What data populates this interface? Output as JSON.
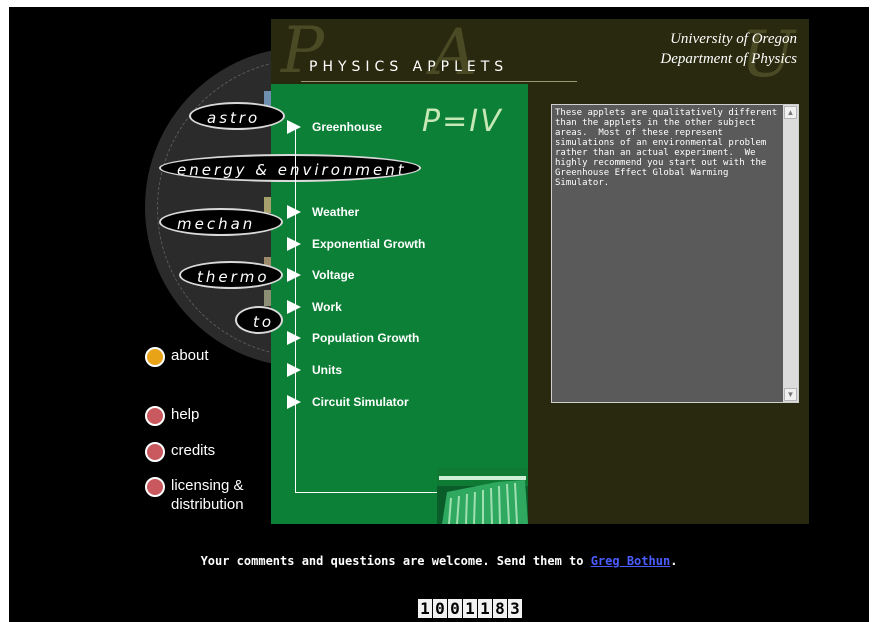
{
  "header": {
    "title": "PHYSICS APPLETS",
    "university": "University of Oregon",
    "department": "Department of Physics"
  },
  "subjects": [
    {
      "label": "astro"
    },
    {
      "label": "energy & environment"
    },
    {
      "label": "mechan"
    },
    {
      "label": "thermo"
    },
    {
      "label": "to"
    }
  ],
  "side_links": [
    {
      "label": "about",
      "color": "#e8a317"
    },
    {
      "label": "help",
      "color": "#c9595f"
    },
    {
      "label": "credits",
      "color": "#c9595f"
    },
    {
      "label": "licensing &\ndistribution",
      "color": "#c9595f"
    }
  ],
  "formula": "P=IV",
  "applets": [
    {
      "label": "Greenhouse"
    },
    {
      "label": "Weather"
    },
    {
      "label": "Exponential Growth"
    },
    {
      "label": "Voltage"
    },
    {
      "label": "Work"
    },
    {
      "label": "Population Growth"
    },
    {
      "label": "Units"
    },
    {
      "label": "Circuit Simulator"
    }
  ],
  "description": "These applets are qualitatively different than the applets in the other subject areas.  Most of these represent simulations of an environmental problem rather than an actual experiment.  We highly recommend you start out with the Greenhouse Effect Global Warming Simulator.",
  "footer": {
    "text": "Your comments and questions are welcome. Send them to ",
    "link": "Greg Bothun",
    "end": "."
  },
  "counter": [
    "1",
    "0",
    "0",
    "1",
    "1",
    "8",
    "3"
  ],
  "colors": {
    "background": "#000000",
    "panel_dark": "#29290f",
    "panel_green": "#0d8037",
    "about_button": "#e8a317",
    "link_button": "#c9595f"
  }
}
